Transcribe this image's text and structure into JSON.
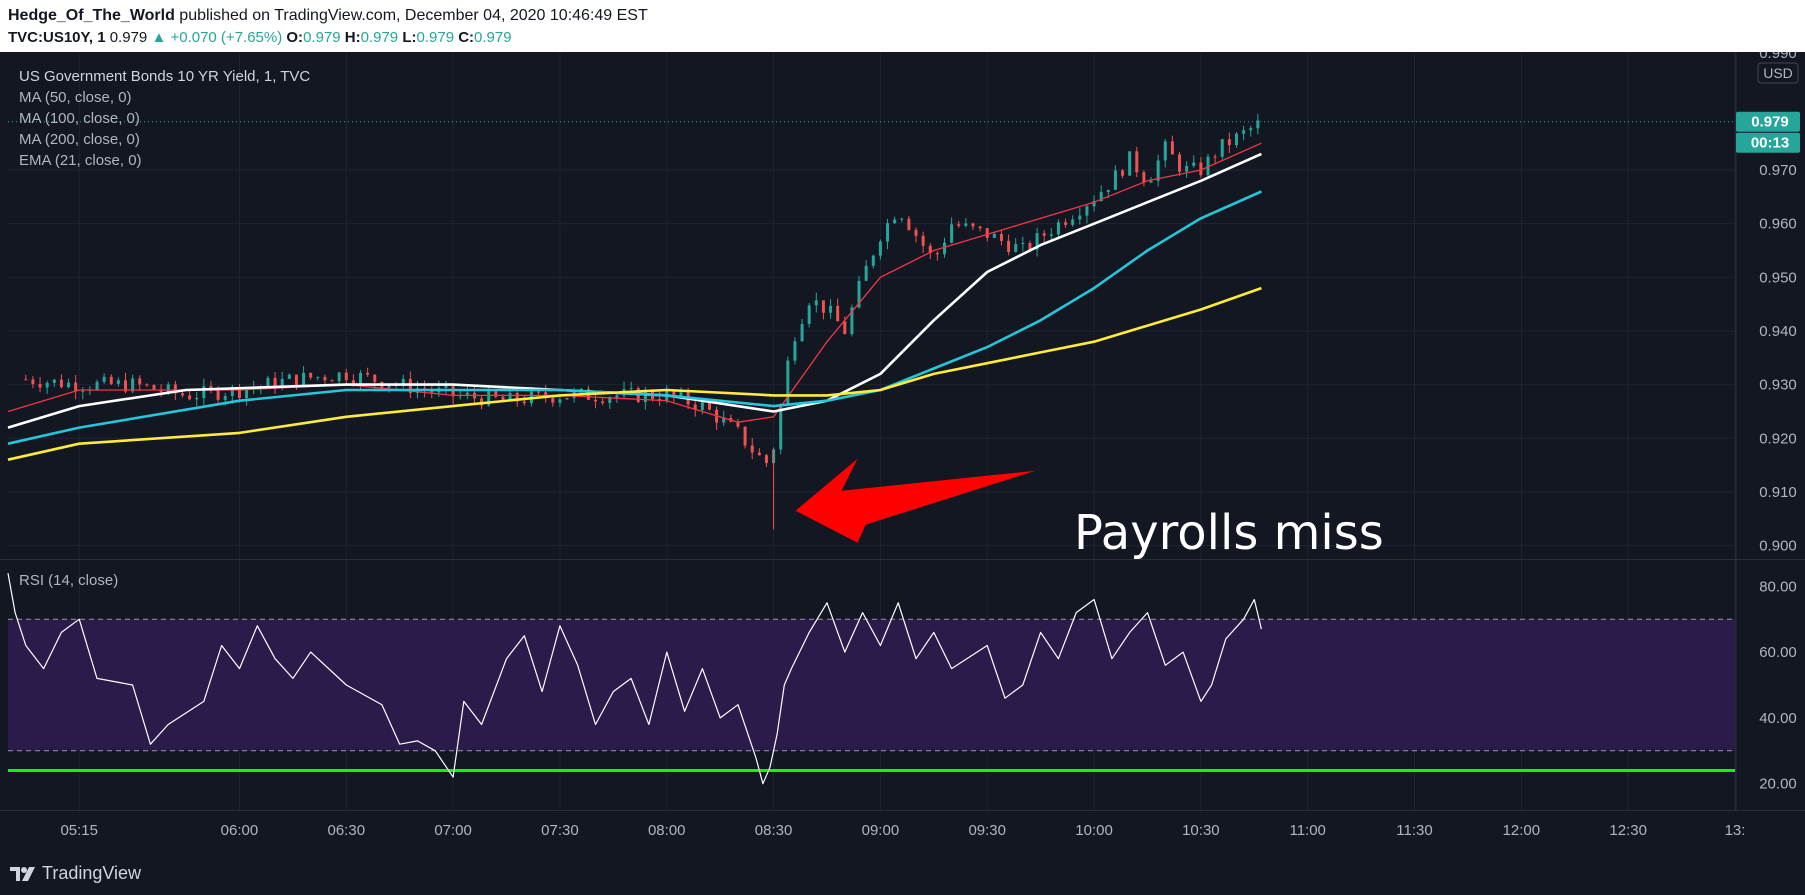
{
  "header": {
    "publisher": "Hedge_Of_The_World",
    "published_text": "published on TradingView.com, December 04, 2020 10:46:49 EST",
    "symbol": "TVC:US10Y, 1",
    "last": "0.979",
    "change_arrow": "▲",
    "change": "+0.070 (+7.65%)",
    "o_label": "O:",
    "o_value": "0.979",
    "h_label": "H:",
    "h_value": "0.979",
    "l_label": "L:",
    "l_value": "0.979",
    "c_label": "C:",
    "c_value": "0.979"
  },
  "legend": {
    "title": "US Government Bonds 10 YR Yield, 1, TVC",
    "ma50": "MA (50, close, 0)",
    "ma100": "MA (100, close, 0)",
    "ma200": "MA (200, close, 0)",
    "ema21": "EMA (21, close, 0)",
    "rsi": "RSI (14, close)"
  },
  "annotation": {
    "text": "Payrolls miss",
    "arrow_color": "#ff0000"
  },
  "price_scale": {
    "currency": "USD",
    "top_partial_label": "0.990",
    "last_price_label": "0.979",
    "countdown_label": "00:13",
    "badge_color": "#26a69a"
  },
  "footer": {
    "brand": "TradingView"
  },
  "colors": {
    "background": "#131722",
    "up_candle": "#26a69a",
    "down_candle": "#ef5350",
    "ema21": "#f23645",
    "ma50": "#ffffff",
    "ma100": "#26c6da",
    "ma200": "#ffeb3b",
    "rsi_line": "#ffffff",
    "rsi_band": "#2a1b4a",
    "rsi_green_line": "#00ff00"
  },
  "icons": {
    "brand_logo": "tradingview-logo-icon"
  },
  "chart_data": [
    {
      "type": "candlestick",
      "title": "US Government Bonds 10 YR Yield, 1, TVC",
      "x_ticks": [
        "05:15",
        "06:00",
        "06:30",
        "07:00",
        "07:30",
        "08:00",
        "08:30",
        "09:00",
        "09:30",
        "10:00",
        "10:30",
        "11:00",
        "11:30",
        "12:00",
        "12:30",
        "13:"
      ],
      "y_ticks": [
        0.97,
        0.96,
        0.95,
        0.94,
        0.93,
        0.92,
        0.91,
        0.9
      ],
      "ylim": [
        0.8975,
        0.992
      ],
      "time_range": [
        "04:55",
        "13:00"
      ],
      "last_price": 0.979,
      "grid": true,
      "close_series": {
        "time": [
          "05:00",
          "05:15",
          "05:30",
          "05:45",
          "06:00",
          "06:15",
          "06:30",
          "06:45",
          "07:00",
          "07:15",
          "07:30",
          "07:45",
          "08:00",
          "08:10",
          "08:20",
          "08:25",
          "08:29",
          "08:31",
          "08:33",
          "08:35",
          "08:40",
          "08:45",
          "08:50",
          "08:55",
          "09:00",
          "09:05",
          "09:10",
          "09:15",
          "09:20",
          "09:30",
          "09:40",
          "09:50",
          "10:00",
          "10:05",
          "10:10",
          "10:15",
          "10:20",
          "10:25",
          "10:30",
          "10:35",
          "10:40",
          "10:45",
          "10:47"
        ],
        "values": [
          0.931,
          0.93,
          0.93,
          0.928,
          0.929,
          0.931,
          0.932,
          0.93,
          0.928,
          0.927,
          0.928,
          0.928,
          0.928,
          0.926,
          0.921,
          0.917,
          0.915,
          0.922,
          0.93,
          0.938,
          0.946,
          0.944,
          0.94,
          0.95,
          0.958,
          0.963,
          0.958,
          0.953,
          0.96,
          0.958,
          0.955,
          0.96,
          0.965,
          0.968,
          0.972,
          0.968,
          0.974,
          0.97,
          0.97,
          0.974,
          0.976,
          0.978,
          0.979
        ]
      },
      "spike_low": {
        "time": "08:30",
        "value": 0.903
      },
      "series": [
        {
          "name": "EMA (21, close, 0)",
          "color": "#f23645",
          "points": [
            [
              "04:55",
              0.925
            ],
            [
              "05:15",
              0.929
            ],
            [
              "06:00",
              0.929
            ],
            [
              "06:30",
              0.93
            ],
            [
              "07:00",
              0.928
            ],
            [
              "07:30",
              0.928
            ],
            [
              "08:00",
              0.927
            ],
            [
              "08:20",
              0.923
            ],
            [
              "08:30",
              0.924
            ],
            [
              "08:45",
              0.938
            ],
            [
              "09:00",
              0.95
            ],
            [
              "09:15",
              0.955
            ],
            [
              "09:30",
              0.958
            ],
            [
              "10:00",
              0.964
            ],
            [
              "10:15",
              0.968
            ],
            [
              "10:30",
              0.97
            ],
            [
              "10:47",
              0.975
            ]
          ]
        },
        {
          "name": "MA (50, close, 0)",
          "color": "#ffffff",
          "points": [
            [
              "04:55",
              0.922
            ],
            [
              "05:15",
              0.926
            ],
            [
              "05:45",
              0.929
            ],
            [
              "06:30",
              0.93
            ],
            [
              "07:00",
              0.93
            ],
            [
              "07:30",
              0.929
            ],
            [
              "08:00",
              0.928
            ],
            [
              "08:30",
              0.925
            ],
            [
              "08:45",
              0.927
            ],
            [
              "09:00",
              0.932
            ],
            [
              "09:15",
              0.942
            ],
            [
              "09:30",
              0.951
            ],
            [
              "09:45",
              0.956
            ],
            [
              "10:00",
              0.96
            ],
            [
              "10:15",
              0.964
            ],
            [
              "10:30",
              0.968
            ],
            [
              "10:47",
              0.973
            ]
          ]
        },
        {
          "name": "MA (100, close, 0)",
          "color": "#26c6da",
          "points": [
            [
              "04:55",
              0.919
            ],
            [
              "05:15",
              0.922
            ],
            [
              "06:00",
              0.927
            ],
            [
              "06:30",
              0.929
            ],
            [
              "07:00",
              0.929
            ],
            [
              "07:30",
              0.929
            ],
            [
              "08:00",
              0.928
            ],
            [
              "08:30",
              0.926
            ],
            [
              "08:45",
              0.927
            ],
            [
              "09:00",
              0.929
            ],
            [
              "09:15",
              0.933
            ],
            [
              "09:30",
              0.937
            ],
            [
              "09:45",
              0.942
            ],
            [
              "10:00",
              0.948
            ],
            [
              "10:15",
              0.955
            ],
            [
              "10:30",
              0.961
            ],
            [
              "10:47",
              0.966
            ]
          ]
        },
        {
          "name": "MA (200, close, 0)",
          "color": "#ffeb3b",
          "points": [
            [
              "04:55",
              0.916
            ],
            [
              "05:15",
              0.919
            ],
            [
              "06:00",
              0.921
            ],
            [
              "06:30",
              0.924
            ],
            [
              "07:00",
              0.926
            ],
            [
              "07:30",
              0.928
            ],
            [
              "08:00",
              0.929
            ],
            [
              "08:30",
              0.928
            ],
            [
              "08:45",
              0.928
            ],
            [
              "09:00",
              0.929
            ],
            [
              "09:15",
              0.932
            ],
            [
              "09:30",
              0.934
            ],
            [
              "09:45",
              0.936
            ],
            [
              "10:00",
              0.938
            ],
            [
              "10:15",
              0.941
            ],
            [
              "10:30",
              0.944
            ],
            [
              "10:47",
              0.948
            ]
          ]
        }
      ]
    },
    {
      "type": "line",
      "title": "RSI (14, close)",
      "y_ticks": [
        80.0,
        60.0,
        40.0,
        20.0
      ],
      "ylim": [
        12,
        88
      ],
      "overbought": 70,
      "oversold": 30,
      "green_level": 24,
      "series": [
        {
          "name": "RSI (14, close)",
          "color": "#ffffff",
          "points": [
            [
              "04:55",
              84
            ],
            [
              "04:57",
              72
            ],
            [
              "05:00",
              62
            ],
            [
              "05:05",
              55
            ],
            [
              "05:10",
              66
            ],
            [
              "05:15",
              70
            ],
            [
              "05:20",
              52
            ],
            [
              "05:30",
              50
            ],
            [
              "05:35",
              32
            ],
            [
              "05:40",
              38
            ],
            [
              "05:50",
              45
            ],
            [
              "05:55",
              62
            ],
            [
              "06:00",
              55
            ],
            [
              "06:05",
              68
            ],
            [
              "06:10",
              58
            ],
            [
              "06:15",
              52
            ],
            [
              "06:20",
              60
            ],
            [
              "06:30",
              50
            ],
            [
              "06:40",
              44
            ],
            [
              "06:45",
              32
            ],
            [
              "06:50",
              33
            ],
            [
              "06:55",
              30
            ],
            [
              "07:00",
              22
            ],
            [
              "07:03",
              45
            ],
            [
              "07:08",
              38
            ],
            [
              "07:15",
              58
            ],
            [
              "07:20",
              65
            ],
            [
              "07:25",
              48
            ],
            [
              "07:30",
              68
            ],
            [
              "07:35",
              56
            ],
            [
              "07:40",
              38
            ],
            [
              "07:45",
              48
            ],
            [
              "07:50",
              52
            ],
            [
              "07:55",
              38
            ],
            [
              "08:00",
              60
            ],
            [
              "08:05",
              42
            ],
            [
              "08:10",
              55
            ],
            [
              "08:15",
              40
            ],
            [
              "08:20",
              44
            ],
            [
              "08:25",
              28
            ],
            [
              "08:27",
              20
            ],
            [
              "08:29",
              25
            ],
            [
              "08:31",
              35
            ],
            [
              "08:33",
              50
            ],
            [
              "08:35",
              55
            ],
            [
              "08:40",
              66
            ],
            [
              "08:45",
              75
            ],
            [
              "08:50",
              60
            ],
            [
              "08:55",
              72
            ],
            [
              "09:00",
              62
            ],
            [
              "09:05",
              75
            ],
            [
              "09:10",
              58
            ],
            [
              "09:15",
              66
            ],
            [
              "09:20",
              55
            ],
            [
              "09:30",
              62
            ],
            [
              "09:35",
              46
            ],
            [
              "09:40",
              50
            ],
            [
              "09:45",
              66
            ],
            [
              "09:50",
              58
            ],
            [
              "09:55",
              72
            ],
            [
              "10:00",
              76
            ],
            [
              "10:05",
              58
            ],
            [
              "10:10",
              66
            ],
            [
              "10:15",
              72
            ],
            [
              "10:20",
              56
            ],
            [
              "10:25",
              60
            ],
            [
              "10:30",
              45
            ],
            [
              "10:33",
              50
            ],
            [
              "10:37",
              64
            ],
            [
              "10:42",
              70
            ],
            [
              "10:45",
              76
            ],
            [
              "10:47",
              67
            ]
          ]
        }
      ]
    }
  ]
}
